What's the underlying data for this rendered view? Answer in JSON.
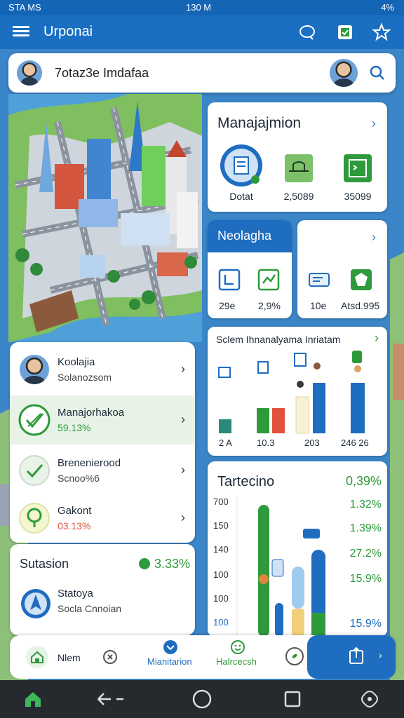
{
  "status_bar": {
    "left": "STA MS",
    "time": "130 M",
    "right": "4%"
  },
  "app_bar": {
    "title": "Urponai",
    "icons": [
      "menu-icon",
      "chat-icon",
      "message-icon",
      "star-icon"
    ]
  },
  "search": {
    "text": "7otaz3e Imdafaa"
  },
  "management": {
    "title": "Manajajmion",
    "items": [
      {
        "label": "Dotat",
        "icon": "document-icon"
      },
      {
        "label": "2,5089",
        "icon": "bridge-icon"
      },
      {
        "label": "35099",
        "icon": "terminal-icon"
      }
    ]
  },
  "neo": {
    "title": "Neolagha",
    "items": [
      {
        "label": "29e",
        "icon": "clipboard-icon"
      },
      {
        "label": "2,9%",
        "icon": "check-image-icon"
      }
    ]
  },
  "neo2": {
    "items": [
      {
        "label": "10e",
        "icon": "ticket-icon"
      },
      {
        "label": "Atsd.995",
        "icon": "shield-icon"
      }
    ]
  },
  "schedule": {
    "title": "Sclem Ihnanalyama Inriatam",
    "values_labels": [
      "2 A",
      "10.3",
      "203",
      "246 26"
    ]
  },
  "trend": {
    "title": "Tartecino",
    "value": "0,39%",
    "y_ticks": [
      "700",
      "150",
      "140",
      "100",
      "100",
      "100"
    ],
    "right_values": [
      "1.32%",
      "1.39%",
      "27.2%",
      "15.9%",
      "15.9%"
    ]
  },
  "list": [
    {
      "title": "Koolajia",
      "subtitle": "Solanozsom",
      "icon": "avatar",
      "selected": false
    },
    {
      "title": "Manajorhakoa",
      "subtitle": "59.13%",
      "icon": "check-icon",
      "selected": true
    },
    {
      "title": "Brenenierood",
      "subtitle": "Scnoo%6",
      "icon": "check-icon",
      "selected": false
    },
    {
      "title": "Gakont",
      "subtitle": "03.13%",
      "icon": "tree-icon",
      "selected": false
    }
  ],
  "stats": {
    "title": "Sutasion",
    "value": "3.33%",
    "item_title": "Statoya",
    "item_subtitle": "Socla Cnnoian"
  },
  "tabs": [
    {
      "label": "Nlem",
      "icon": "home-icon"
    },
    {
      "label": "",
      "icon": "clock-icon"
    },
    {
      "label": "Mianitarion",
      "icon": "chevron-down-icon"
    },
    {
      "label": "Halrcecsh",
      "icon": "face-icon"
    },
    {
      "label": "",
      "icon": "plant-icon"
    },
    {
      "label": "",
      "icon": "share-icon"
    }
  ],
  "colors": {
    "primary": "#1f6dc0",
    "green": "#2f9a3b",
    "red": "#e0523b"
  }
}
